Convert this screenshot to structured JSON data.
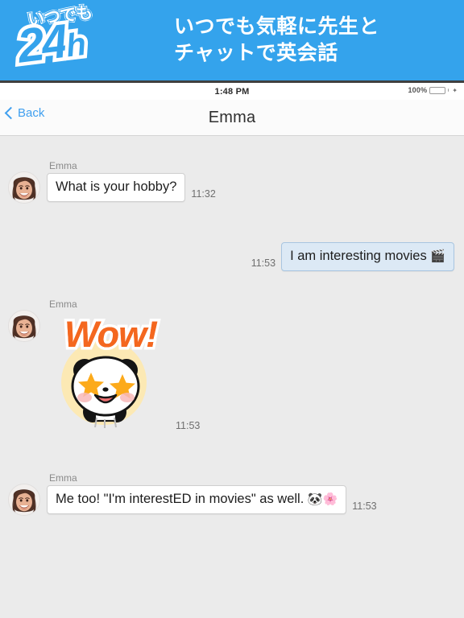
{
  "promo": {
    "logo_top_text": "いつでも",
    "logo_main_text": "24",
    "logo_suffix_text": "h",
    "headline_line1": "いつでも気軽に先生と",
    "headline_line2": "チャットで英会話",
    "background_color": "#34a3ec"
  },
  "status_bar": {
    "time": "1:48 PM",
    "battery_percent": "100%",
    "battery_icon": "battery-icon",
    "charging_icon": "charging-bolt-icon",
    "battery_color": "#5ede72"
  },
  "nav_bar": {
    "back_label": "Back",
    "back_icon": "chevron-left-icon",
    "title": "Emma",
    "accent_color": "#3f9fef"
  },
  "chat": {
    "background_color": "#ebebeb",
    "sent_bubble_color": "#dce9f5",
    "received_bubble_color": "#ffffff",
    "messages": [
      {
        "id": "msg-1",
        "direction": "incoming",
        "sender": "Emma",
        "avatar_icon": "avatar-emma",
        "text": "What is your hobby?",
        "time": "11:32",
        "type": "text"
      },
      {
        "id": "msg-2",
        "direction": "outgoing",
        "sender": "",
        "text": "I am interesting movies",
        "emoji": "🎬",
        "time": "11:53",
        "type": "text"
      },
      {
        "id": "msg-3",
        "direction": "incoming",
        "sender": "Emma",
        "avatar_icon": "avatar-emma",
        "sticker_text": "Wow!",
        "sticker_name": "panda-wow-sticker",
        "time": "11:53",
        "type": "sticker"
      },
      {
        "id": "msg-4",
        "direction": "incoming",
        "sender": "Emma",
        "avatar_icon": "avatar-emma",
        "text": "Me too! \"I'm interestED in movies\" as well.",
        "emoji": "🐼🌸",
        "time": "11:53",
        "type": "text"
      }
    ]
  }
}
